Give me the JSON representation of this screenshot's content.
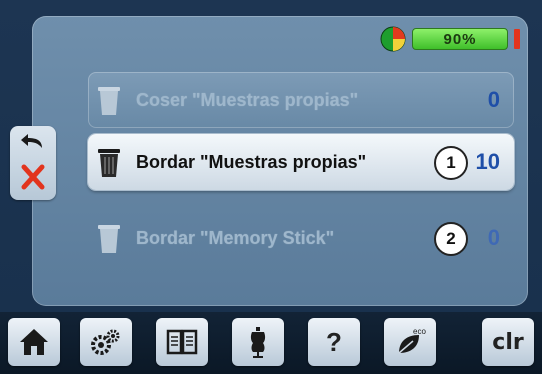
{
  "status": {
    "battery_text": "90%",
    "pie_icon": "pie-chart-icon",
    "battery_color": "#3fbf2a",
    "warning_color": "#e2341d"
  },
  "rows": [
    {
      "label": "Coser \"Muestras propias\"",
      "count": "0",
      "state": "dimmed"
    },
    {
      "label": "Bordar \"Muestras propias\"",
      "count": "10",
      "state": "selected"
    },
    {
      "label": "Bordar \"Memory Stick\"",
      "count": "0",
      "state": "disabled"
    }
  ],
  "callouts": [
    "1",
    "2"
  ],
  "side": {
    "back_icon": "back-arrow-icon",
    "close_icon": "close-x-icon"
  },
  "toolbar": {
    "home_icon": "home-icon",
    "settings_icon": "settings-gears-icon",
    "manual_icon": "open-book-icon",
    "tutorial_icon": "dress-form-icon",
    "help_label": "?",
    "eco_label": "eco",
    "clr_label": "clr"
  }
}
